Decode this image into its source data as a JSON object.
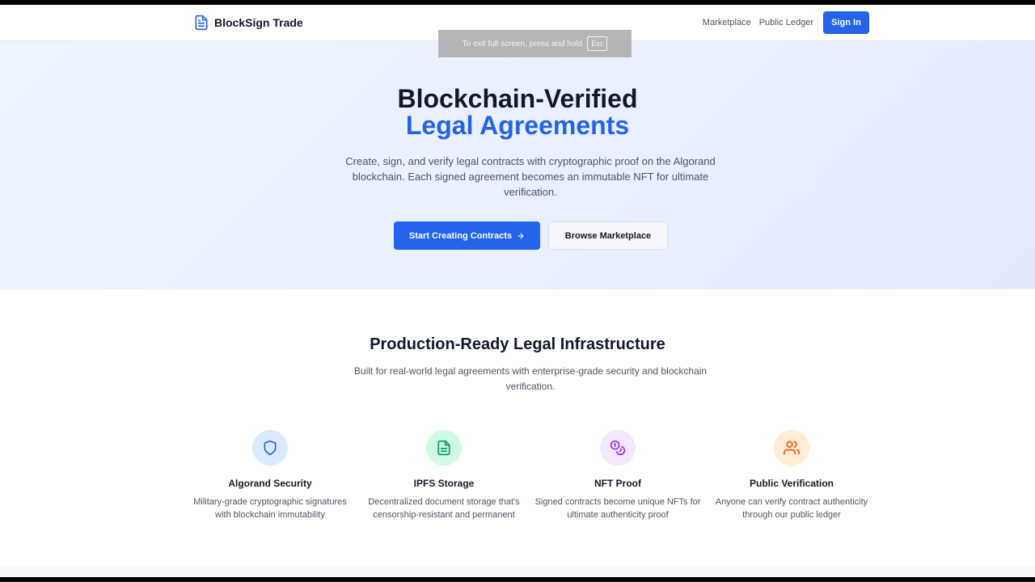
{
  "header": {
    "brand": "BlockSign Trade",
    "nav": [
      "Marketplace",
      "Public Ledger"
    ],
    "signin_label": "Sign In"
  },
  "toast": {
    "text": "To exit full screen, press and hold",
    "key": "Esc"
  },
  "hero": {
    "title_line1": "Blockchain-Verified",
    "title_line2": "Legal Agreements",
    "subtitle": "Create, sign, and verify legal contracts with cryptographic proof on the Algorand blockchain. Each signed agreement becomes an immutable NFT for ultimate verification.",
    "primary_cta": "Start Creating Contracts",
    "secondary_cta": "Browse Marketplace"
  },
  "features": {
    "title": "Production-Ready Legal Infrastructure",
    "subtitle": "Built for real-world legal agreements with enterprise-grade security and blockchain verification.",
    "items": [
      {
        "icon": "shield-icon",
        "title": "Algorand Security",
        "desc": "Military-grade cryptographic signatures with blockchain immutability",
        "bg": "#dbeafe",
        "fg": "#2563eb"
      },
      {
        "icon": "file-text-icon",
        "title": "IPFS Storage",
        "desc": "Decentralized document storage that's censorship-resistant and permanent",
        "bg": "#d1fae5",
        "fg": "#059669"
      },
      {
        "icon": "coins-icon",
        "title": "NFT Proof",
        "desc": "Signed contracts become unique NFTs for ultimate authenticity proof",
        "bg": "#f3e8ff",
        "fg": "#9333ea"
      },
      {
        "icon": "users-icon",
        "title": "Public Verification",
        "desc": "Anyone can verify contract authenticity through our public ledger",
        "bg": "#ffedd5",
        "fg": "#ea580c"
      }
    ]
  },
  "colors": {
    "accent": "#2563eb",
    "text": "#111827",
    "muted": "#4b5563"
  }
}
